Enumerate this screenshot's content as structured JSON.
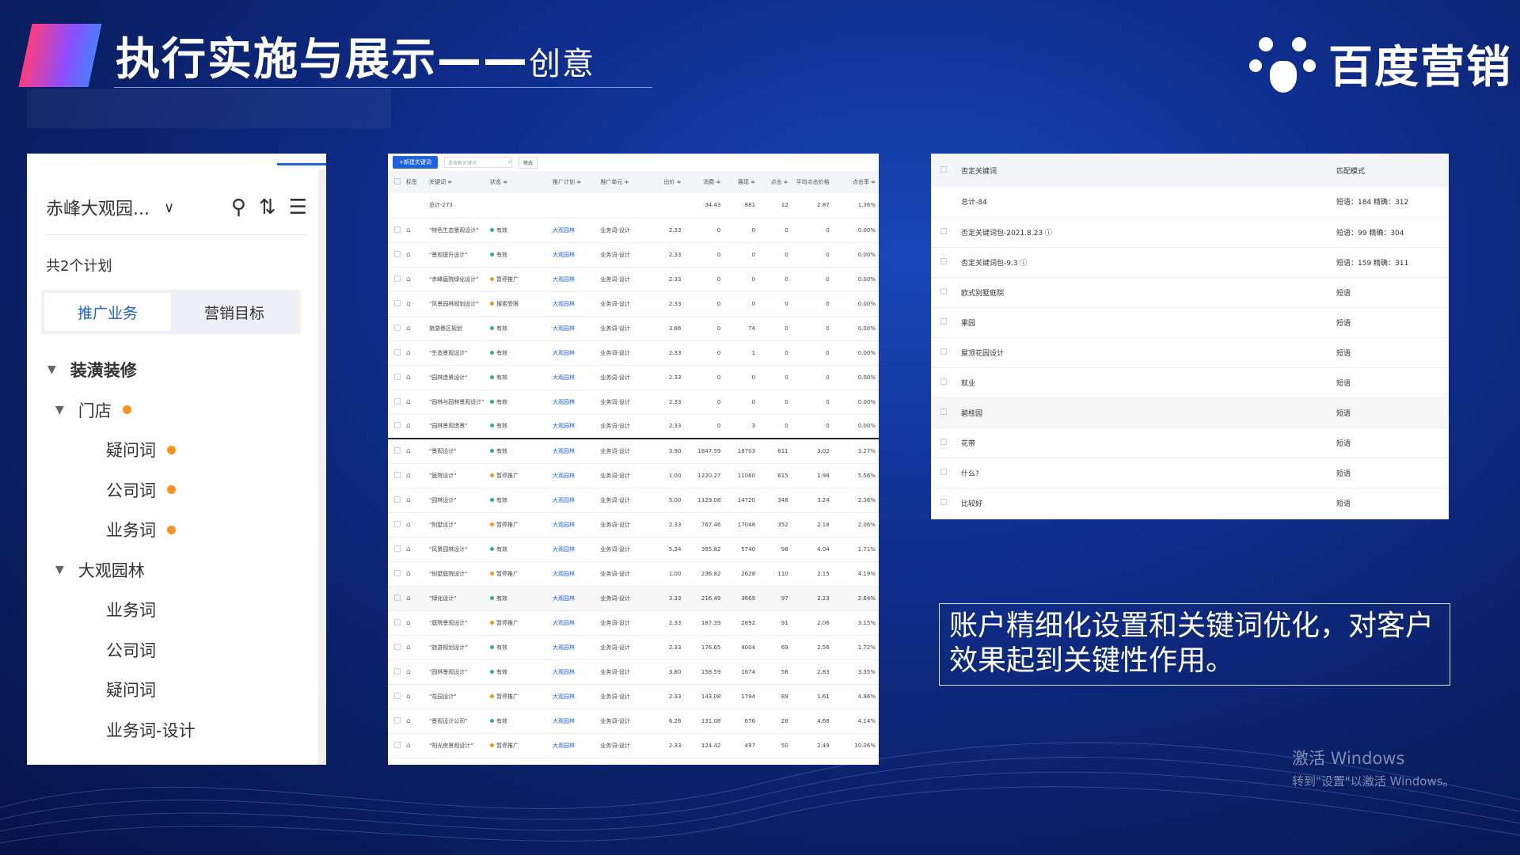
{
  "slide": {
    "title": "执行实施与展示——",
    "title_suffix": "创意",
    "brand": "百度营销",
    "callout": "账户精细化设置和关键词优化，对客户效果起到关键性作用。",
    "activation": {
      "line1": "激活 Windows",
      "line2": "转到\"设置\"以激活 Windows。"
    }
  },
  "left_panel": {
    "account": "赤峰大观园...",
    "plan_count": "共2个计划",
    "tabs": [
      {
        "label": "推广业务",
        "active": true
      },
      {
        "label": "营销目标",
        "active": false
      }
    ],
    "tree": [
      {
        "label": "装潢装修",
        "level": 0,
        "caret": true,
        "bold": true,
        "dot": false
      },
      {
        "label": "门店",
        "level": 1,
        "caret": true,
        "bold": false,
        "dot": true
      },
      {
        "label": "疑问词",
        "level": 2,
        "caret": false,
        "bold": false,
        "dot": true
      },
      {
        "label": "公司词",
        "level": 2,
        "caret": false,
        "bold": false,
        "dot": true
      },
      {
        "label": "业务词",
        "level": 2,
        "caret": false,
        "bold": false,
        "dot": true
      },
      {
        "label": "大观园林",
        "level": 1,
        "caret": true,
        "bold": false,
        "dot": false
      },
      {
        "label": "业务词",
        "level": 2,
        "caret": false,
        "bold": false,
        "dot": false
      },
      {
        "label": "公司词",
        "level": 2,
        "caret": false,
        "bold": false,
        "dot": false
      },
      {
        "label": "疑问词",
        "level": 2,
        "caret": false,
        "bold": false,
        "dot": false
      },
      {
        "label": "业务词-设计",
        "level": 2,
        "caret": false,
        "bold": false,
        "dot": false
      }
    ],
    "status_color": "#f7931e"
  },
  "mid_panel": {
    "toolbar": {
      "new_btn": "+新建关键词",
      "search_placeholder": "请搜索关键词",
      "filter_btn": "筛选"
    },
    "headers": [
      "标签",
      "关键词 ≑",
      "状态 ≑",
      "推广计划 ≑",
      "推广单元 ≑",
      "出价 ≑",
      "消费 ≑",
      "展现 ≑",
      "点击 ≑",
      "平均点击价格",
      "点击率 ≑"
    ],
    "total": {
      "keyword": "总计-273",
      "cost": "34.43",
      "impr": "881",
      "click": "12",
      "cpc": "2.87",
      "ctr": "1.36%"
    },
    "rows": [
      {
        "kw": "\"特色生态景观设计\"",
        "status": "有效",
        "sc": "#2bb673",
        "plan": "大观园林",
        "unit": "业务词-设计",
        "bid": "2.33",
        "cost": "0",
        "impr": "0",
        "click": "0",
        "cpc": "0",
        "ctr": "0.00%"
      },
      {
        "kw": "\"景观提升设计\"",
        "status": "有效",
        "sc": "#2bb673",
        "plan": "大观园林",
        "unit": "业务词-设计",
        "bid": "2.33",
        "cost": "0",
        "impr": "0",
        "click": "0",
        "cpc": "0",
        "ctr": "0.00%"
      },
      {
        "kw": "\"赤峰庭院绿化设计\"",
        "status": "暂停推广",
        "sc": "#f7931e",
        "plan": "大观园林",
        "unit": "业务词-设计",
        "bid": "2.33",
        "cost": "0",
        "impr": "0",
        "click": "0",
        "cpc": "0",
        "ctr": "0.00%"
      },
      {
        "kw": "\"风景园林规划设计\"",
        "status": "搜索受限",
        "sc": "#f7931e",
        "plan": "大观园林",
        "unit": "业务词-设计",
        "bid": "2.33",
        "cost": "0",
        "impr": "0",
        "click": "0",
        "cpc": "0",
        "ctr": "0.00%"
      },
      {
        "kw": "旅游景区规划",
        "status": "有效",
        "sc": "#2bb673",
        "plan": "大观园林",
        "unit": "业务词-设计",
        "bid": "3.86",
        "cost": "0",
        "impr": "74",
        "click": "0",
        "cpc": "0",
        "ctr": "0.00%"
      },
      {
        "kw": "\"生态景观设计\"",
        "status": "有效",
        "sc": "#2bb673",
        "plan": "大观园林",
        "unit": "业务词-设计",
        "bid": "2.33",
        "cost": "0",
        "impr": "1",
        "click": "0",
        "cpc": "0",
        "ctr": "0.00%"
      },
      {
        "kw": "\"园林造景设计\"",
        "status": "有效",
        "sc": "#2bb673",
        "plan": "大观园林",
        "unit": "业务词-设计",
        "bid": "2.33",
        "cost": "0",
        "impr": "0",
        "click": "0",
        "cpc": "0",
        "ctr": "0.00%"
      },
      {
        "kw": "\"园林与园林景观设计\"",
        "status": "有效",
        "sc": "#2bb673",
        "plan": "大观园林",
        "unit": "业务词-设计",
        "bid": "2.33",
        "cost": "0",
        "impr": "0",
        "click": "0",
        "cpc": "0",
        "ctr": "0.00%"
      },
      {
        "kw": "\"园林景观造景\"",
        "status": "有效",
        "sc": "#2bb673",
        "plan": "大观园林",
        "unit": "业务词-设计",
        "bid": "2.33",
        "cost": "0",
        "impr": "3",
        "click": "0",
        "cpc": "0",
        "ctr": "0.00%"
      },
      {
        "kw": "\"景观设计\"",
        "status": "有效",
        "sc": "#2bb673",
        "plan": "大观园林",
        "unit": "业务词-设计",
        "bid": "3.90",
        "cost": "1847.59",
        "impr": "18703",
        "click": "611",
        "cpc": "3.02",
        "ctr": "3.27%"
      },
      {
        "kw": "\"庭院设计\"",
        "status": "暂停推广",
        "sc": "#f7931e",
        "plan": "大观园林",
        "unit": "业务词-设计",
        "bid": "1.00",
        "cost": "1220.27",
        "impr": "11060",
        "click": "615",
        "cpc": "1.98",
        "ctr": "5.56%"
      },
      {
        "kw": "\"园林设计\"",
        "status": "有效",
        "sc": "#2bb673",
        "plan": "大观园林",
        "unit": "业务词-设计",
        "bid": "5.00",
        "cost": "1129.08",
        "impr": "14720",
        "click": "348",
        "cpc": "3.24",
        "ctr": "2.36%"
      },
      {
        "kw": "\"别墅设计\"",
        "status": "暂停推广",
        "sc": "#f7931e",
        "plan": "大观园林",
        "unit": "业务词-设计",
        "bid": "2.33",
        "cost": "767.46",
        "impr": "17048",
        "click": "352",
        "cpc": "2.18",
        "ctr": "2.06%"
      },
      {
        "kw": "\"风景园林设计\"",
        "status": "有效",
        "sc": "#2bb673",
        "plan": "大观园林",
        "unit": "业务词-设计",
        "bid": "5.34",
        "cost": "395.82",
        "impr": "5740",
        "click": "98",
        "cpc": "4.04",
        "ctr": "1.71%"
      },
      {
        "kw": "\"别墅庭院设计\"",
        "status": "暂停推广",
        "sc": "#f7931e",
        "plan": "大观园林",
        "unit": "业务词-设计",
        "bid": "1.00",
        "cost": "236.82",
        "impr": "2628",
        "click": "110",
        "cpc": "2.15",
        "ctr": "4.19%"
      },
      {
        "kw": "\"绿化设计\"",
        "status": "有效",
        "sc": "#2bb673",
        "plan": "大观园林",
        "unit": "业务词-设计",
        "bid": "3.33",
        "cost": "216.49",
        "impr": "3669",
        "click": "97",
        "cpc": "2.23",
        "ctr": "2.64%",
        "hl": true
      },
      {
        "kw": "\"庭院景观设计\"",
        "status": "暂停推广",
        "sc": "#f7931e",
        "plan": "大观园林",
        "unit": "业务词-设计",
        "bid": "2.33",
        "cost": "187.39",
        "impr": "2892",
        "click": "91",
        "cpc": "2.06",
        "ctr": "3.15%"
      },
      {
        "kw": "\"旅游规划设计\"",
        "status": "有效",
        "sc": "#2bb673",
        "plan": "大观园林",
        "unit": "业务词-设计",
        "bid": "2.33",
        "cost": "176.65",
        "impr": "4004",
        "click": "69",
        "cpc": "2.56",
        "ctr": "1.72%"
      },
      {
        "kw": "\"园林景观设计\"",
        "status": "有效",
        "sc": "#2bb673",
        "plan": "大观园林",
        "unit": "业务词-设计",
        "bid": "3.80",
        "cost": "158.59",
        "impr": "1674",
        "click": "56",
        "cpc": "2.83",
        "ctr": "3.35%"
      },
      {
        "kw": "\"花园设计\"",
        "status": "暂停推广",
        "sc": "#f7931e",
        "plan": "大观园林",
        "unit": "业务词-设计",
        "bid": "2.33",
        "cost": "143.08",
        "impr": "1794",
        "click": "89",
        "cpc": "1.61",
        "ctr": "4.96%"
      },
      {
        "kw": "\"景观设计公司\"",
        "status": "有效",
        "sc": "#2bb673",
        "plan": "大观园林",
        "unit": "业务词-设计",
        "bid": "6.26",
        "cost": "131.08",
        "impr": "676",
        "click": "28",
        "cpc": "4.68",
        "ctr": "4.14%"
      },
      {
        "kw": "\"阳光房景观设计\"",
        "status": "暂停推广",
        "sc": "#f7931e",
        "plan": "大观园林",
        "unit": "业务词-设计",
        "bid": "2.33",
        "cost": "124.42",
        "impr": "497",
        "click": "50",
        "cpc": "2.49",
        "ctr": "10.06%"
      }
    ]
  },
  "right_panel": {
    "headers": [
      "否定关键词",
      "匹配模式"
    ],
    "rows": [
      {
        "name": "总计-84",
        "mode": "短语：184   精确：312",
        "cb": false
      },
      {
        "name": "否定关键词包-2021.8.23 ⓘ",
        "mode": "短语：99   精确：304",
        "cb": true
      },
      {
        "name": "否定关键词包-9.3 ⓘ",
        "mode": "短语：159   精确：311",
        "cb": true
      },
      {
        "name": "欧式别墅庭院",
        "mode": "短语",
        "cb": true
      },
      {
        "name": "果园",
        "mode": "短语",
        "cb": true
      },
      {
        "name": "屋顶花园设计",
        "mode": "短语",
        "cb": true
      },
      {
        "name": "就业",
        "mode": "短语",
        "cb": true
      },
      {
        "name": "碧桂园",
        "mode": "短语",
        "cb": true,
        "hl": true
      },
      {
        "name": "花带",
        "mode": "短语",
        "cb": true
      },
      {
        "name": "什么?",
        "mode": "短语",
        "cb": true
      },
      {
        "name": "比较好",
        "mode": "短语",
        "cb": true
      }
    ]
  }
}
